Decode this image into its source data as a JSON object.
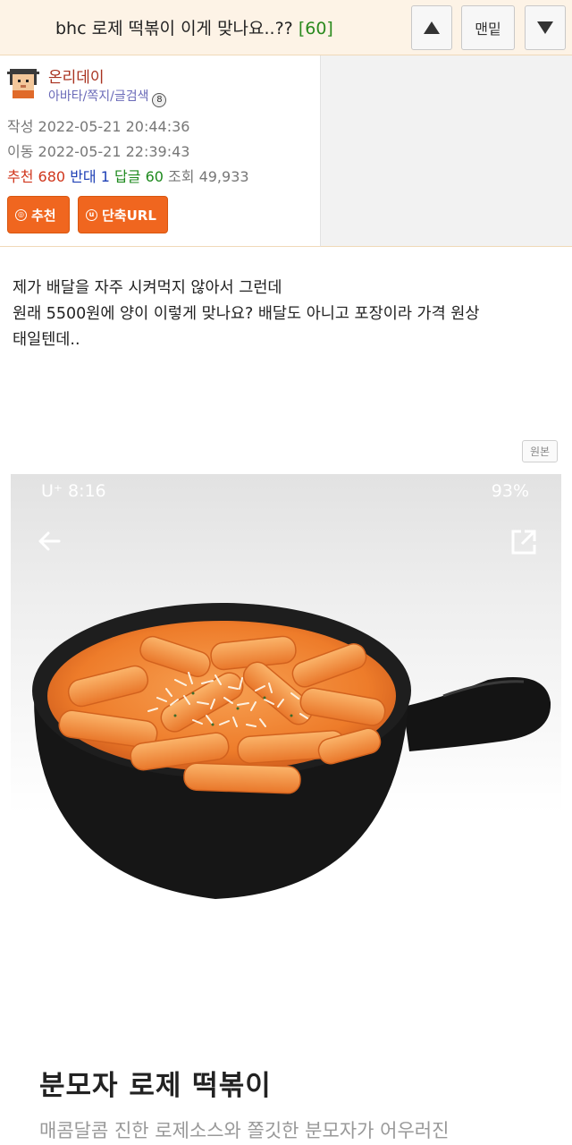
{
  "topbar": {
    "title": "bhc 로제 떡볶이 이게 맞나요..??",
    "reply_count": "[60]",
    "up_icon": "triangle-up-icon",
    "bottom_label": "맨밑",
    "down_icon": "triangle-down-icon"
  },
  "author": {
    "nickname": "온리데이",
    "links": "아바타/쪽지/글검색",
    "level": "8",
    "written_label": "작성",
    "written": "2022-05-21 20:44:36",
    "moved_label": "이동",
    "moved": "2022-05-21 22:39:43",
    "stats": {
      "rec_label": "추천",
      "rec": "680",
      "against_label": "반대",
      "against": "1",
      "reply_label": "답글",
      "reply": "60",
      "view_label": "조회",
      "view": "49,933"
    },
    "recommend_button": "추천",
    "short_url_button": "단축URL"
  },
  "post": {
    "lines": [
      "제가 배달을 자주 시켜먹지 않아서 그런데",
      "원래 5500원에 양이 이렇게 맞나요? 배달도 아니고 포장이라 가격 원상",
      "태일텐데.."
    ],
    "original_button": "원본"
  },
  "screenshot": {
    "status_left": "U⁺ 8:16",
    "status_right": "93%",
    "product_title": "분모자 로제 떡볶이",
    "product_desc": "매콤달콤 진한 로제소스와 쫄깃한 분모자가 어우러진"
  },
  "colors": {
    "title_bar_bg": "#fdf3e6",
    "reply_count": "#2a8a1e",
    "button_orange": "#f0661f",
    "nickname": "#a8321f"
  }
}
